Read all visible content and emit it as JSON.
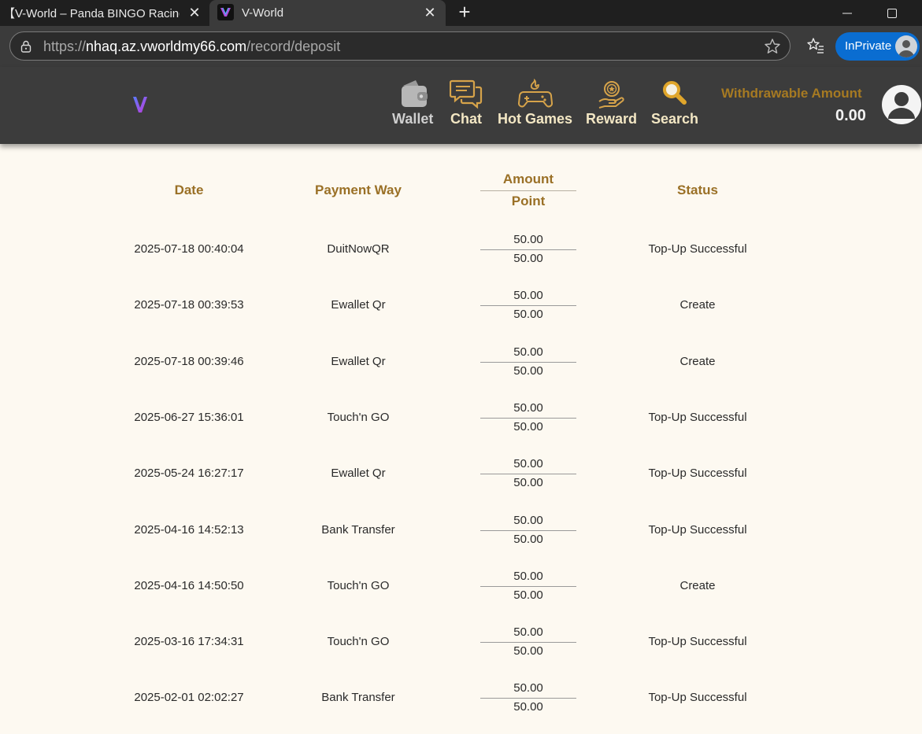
{
  "browser": {
    "tabs": [
      {
        "title": "【V-World – Panda BINGO Racing f",
        "active": false
      },
      {
        "title": "V-World",
        "active": true
      }
    ],
    "url_prefix": "https://",
    "url_host": "nhaq.az.vworldmy66.com",
    "url_path": "/record/deposit",
    "inprivate_label": "InPrivate"
  },
  "nav": {
    "items": [
      {
        "label": "Wallet",
        "icon": "wallet-icon",
        "color": "#cfcfcf"
      },
      {
        "label": "Chat",
        "icon": "chat-icon",
        "color": "#f3e7c4"
      },
      {
        "label": "Hot Games",
        "icon": "gamepad-icon",
        "color": "#f3e7c4"
      },
      {
        "label": "Reward",
        "icon": "reward-icon",
        "color": "#f3e7c4"
      },
      {
        "label": "Search",
        "icon": "search-icon",
        "color": "#f3e7c4"
      }
    ],
    "withdrawable_label": "Withdrawable Amount",
    "withdrawable_amount": "0.00"
  },
  "table": {
    "headers": {
      "date": "Date",
      "payment_way": "Payment Way",
      "amount": "Amount",
      "point": "Point",
      "status": "Status"
    },
    "rows": [
      {
        "date": "2025-07-18 00:40:04",
        "payment_way": "DuitNowQR",
        "amount": "50.00",
        "point": "50.00",
        "status": "Top-Up Successful"
      },
      {
        "date": "2025-07-18 00:39:53",
        "payment_way": "Ewallet Qr",
        "amount": "50.00",
        "point": "50.00",
        "status": "Create"
      },
      {
        "date": "2025-07-18 00:39:46",
        "payment_way": "Ewallet Qr",
        "amount": "50.00",
        "point": "50.00",
        "status": "Create"
      },
      {
        "date": "2025-06-27 15:36:01",
        "payment_way": "Touch'n GO",
        "amount": "50.00",
        "point": "50.00",
        "status": "Top-Up Successful"
      },
      {
        "date": "2025-05-24 16:27:17",
        "payment_way": "Ewallet Qr",
        "amount": "50.00",
        "point": "50.00",
        "status": "Top-Up Successful"
      },
      {
        "date": "2025-04-16 14:52:13",
        "payment_way": "Bank Transfer",
        "amount": "50.00",
        "point": "50.00",
        "status": "Top-Up Successful"
      },
      {
        "date": "2025-04-16 14:50:50",
        "payment_way": "Touch'n GO",
        "amount": "50.00",
        "point": "50.00",
        "status": "Create"
      },
      {
        "date": "2025-03-16 17:34:31",
        "payment_way": "Touch'n GO",
        "amount": "50.00",
        "point": "50.00",
        "status": "Top-Up Successful"
      },
      {
        "date": "2025-02-01 02:02:27",
        "payment_way": "Bank Transfer",
        "amount": "50.00",
        "point": "50.00",
        "status": "Top-Up Successful"
      }
    ]
  },
  "colors": {
    "header_bg": "#3c3c3c",
    "accent_gold": "#a67a22",
    "table_header": "#9a7026",
    "page_bg": "#fdf9f1"
  }
}
